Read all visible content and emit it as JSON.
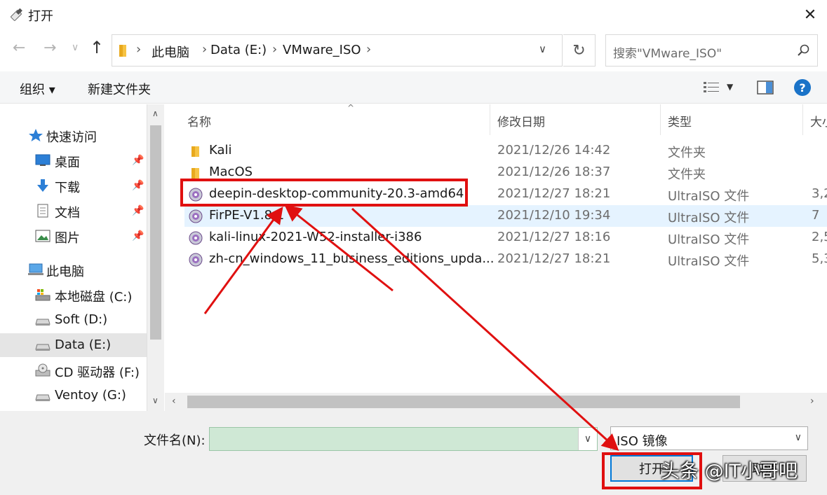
{
  "window": {
    "title": "打开",
    "close_glyph": "✕"
  },
  "address": {
    "crumbs": [
      "此电脑",
      "Data (E:)",
      "VMware_ISO"
    ],
    "separator": "›"
  },
  "search": {
    "placeholder": "搜索\"VMware_ISO\""
  },
  "toolbar": {
    "organize": "组织 ▾",
    "new_folder": "新建文件夹",
    "help": "?"
  },
  "navpane": {
    "items": [
      {
        "label": "快速访问",
        "icon": "star-icon",
        "pinned": false
      },
      {
        "label": "桌面",
        "icon": "desktop-icon",
        "pinned": true
      },
      {
        "label": "下载",
        "icon": "download-icon",
        "pinned": true
      },
      {
        "label": "文档",
        "icon": "document-icon",
        "pinned": true
      },
      {
        "label": "图片",
        "icon": "picture-icon",
        "pinned": true
      },
      {
        "label": "此电脑",
        "icon": "computer-icon",
        "pinned": false
      },
      {
        "label": "本地磁盘 (C:)",
        "icon": "system-drive-icon",
        "pinned": false
      },
      {
        "label": "Soft (D:)",
        "icon": "drive-icon",
        "pinned": false
      },
      {
        "label": "Data (E:)",
        "icon": "drive-icon",
        "pinned": false,
        "selected": true
      },
      {
        "label": "CD 驱动器 (F:)",
        "icon": "cd-drive-icon",
        "pinned": false
      },
      {
        "label": "Ventoy (G:)",
        "icon": "drive-icon",
        "pinned": false
      }
    ]
  },
  "filelist": {
    "columns": [
      "名称",
      "修改日期",
      "类型",
      "大小"
    ],
    "rows": [
      {
        "name": "Kali",
        "date": "2021/12/26 14:42",
        "type": "文件夹",
        "size": "",
        "icon": "folder-icon"
      },
      {
        "name": "MacOS",
        "date": "2021/12/26 18:37",
        "type": "文件夹",
        "size": "",
        "icon": "folder-icon"
      },
      {
        "name": "deepin-desktop-community-20.3-amd64",
        "date": "2021/12/27 18:21",
        "type": "UltraISO 文件",
        "size": "3,2",
        "icon": "disc-image-icon"
      },
      {
        "name": "FirPE-V1.8.1",
        "date": "2021/12/10 19:34",
        "type": "UltraISO 文件",
        "size": "7",
        "icon": "disc-image-icon",
        "hover": true
      },
      {
        "name": "kali-linux-2021-W52-installer-i386",
        "date": "2021/12/27 18:16",
        "type": "UltraISO 文件",
        "size": "2,5",
        "icon": "disc-image-icon"
      },
      {
        "name": "zh-cn_windows_11_business_editions_upda...",
        "date": "2021/12/27 18:21",
        "type": "UltraISO 文件",
        "size": "5,3",
        "icon": "disc-image-icon"
      }
    ]
  },
  "bottom": {
    "filename_label": "文件名(N):",
    "filename_value": "",
    "filter_value": "ISO 镜像",
    "open_label": "打开",
    "cancel_label": "取消"
  },
  "watermark": "头条 @IT小哥吧",
  "colors": {
    "annotation_red": "#e01010",
    "selection_blue": "#e5f3ff",
    "filename_bg": "#cfe8d5",
    "accent": "#0078d7"
  }
}
